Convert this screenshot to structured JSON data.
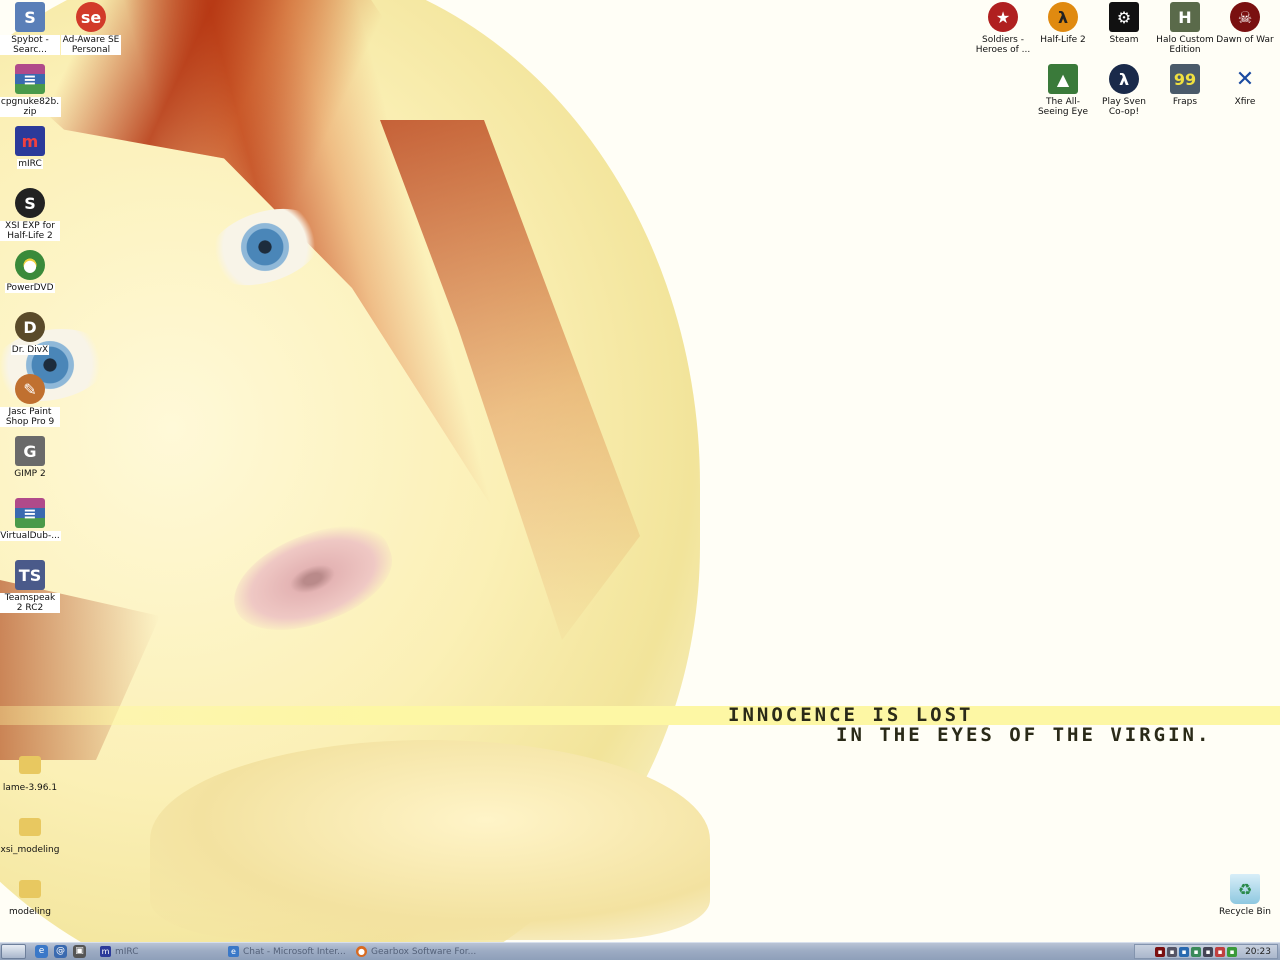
{
  "wallpaper": {
    "line1": "INNOCENCE IS LOST",
    "line2": "IN THE EYES OF THE VIRGIN."
  },
  "desktop_icons_left": [
    {
      "label": "Spybot - Searc...",
      "icon": "spybot-icon",
      "color": "#5a7fb8"
    },
    {
      "label": "Ad-Aware SE Personal",
      "icon": "ad-aware-icon",
      "color": "#d23a2a"
    },
    {
      "label": "cpgnuke82b.zip",
      "icon": "winrar-archive-icon",
      "color": "#8a3a7a"
    },
    {
      "label": "mIRC",
      "icon": "mirc-icon",
      "color": "#2b3a9a"
    },
    {
      "label": "XSI EXP for Half-Life 2",
      "icon": "xsi-icon",
      "color": "#222222"
    },
    {
      "label": "PowerDVD",
      "icon": "powerdvd-icon",
      "color": "#3a8a3a"
    },
    {
      "label": "Dr. DivX",
      "icon": "drdivx-icon",
      "color": "#5a4a2a"
    },
    {
      "label": "Jasc Paint Shop Pro 9",
      "icon": "paintshop-icon",
      "color": "#c07030"
    },
    {
      "label": "GIMP 2",
      "icon": "gimp-icon",
      "color": "#6a6a6a"
    },
    {
      "label": "VirtualDub-...",
      "icon": "winrar-archive-icon",
      "color": "#8a3a7a"
    },
    {
      "label": "Teamspeak 2 RC2",
      "icon": "teamspeak-icon",
      "color": "#4a5a8a"
    },
    {
      "label": "lame-3.96.1",
      "icon": "folder-icon",
      "color": "#e8c860"
    },
    {
      "label": "xsi_modeling",
      "icon": "folder-icon",
      "color": "#e8c860"
    },
    {
      "label": "modeling",
      "icon": "folder-icon",
      "color": "#e8c860"
    }
  ],
  "desktop_icons_right": [
    {
      "label": "Soldiers - Heroes of ...",
      "icon": "soldiers-icon",
      "color": "#b02020"
    },
    {
      "label": "Half-Life 2",
      "icon": "half-life-icon",
      "color": "#e08a10"
    },
    {
      "label": "Steam",
      "icon": "steam-icon",
      "color": "#111111"
    },
    {
      "label": "Halo Custom Edition",
      "icon": "halo-icon",
      "color": "#5a6a4a"
    },
    {
      "label": "Dawn of War",
      "icon": "dawn-of-war-icon",
      "color": "#7a1010"
    },
    {
      "label": "The All-Seeing Eye",
      "icon": "all-seeing-eye-icon",
      "color": "#3a7a3a"
    },
    {
      "label": "Play Sven Co-op!",
      "icon": "sven-coop-icon",
      "color": "#1a2a4a"
    },
    {
      "label": "Fraps",
      "icon": "fraps-icon",
      "color": "#4a5a6a"
    },
    {
      "label": "Xfire",
      "icon": "xfire-icon",
      "color": "#1a4aa0"
    }
  ],
  "recycle_bin": {
    "label": "Recycle Bin",
    "icon": "recycle-bin-icon",
    "color": "#3a9a5a"
  },
  "taskbar": {
    "tasks": [
      {
        "label": "mIRC",
        "icon": "mirc-icon",
        "color": "#2b3a9a"
      },
      {
        "label": "Chat - Microsoft Inter...",
        "icon": "internet-explorer-icon",
        "color": "#3a78c8"
      },
      {
        "label": "Gearbox Software For...",
        "icon": "firefox-icon",
        "color": "#d86a20"
      }
    ],
    "clock": "20:23"
  }
}
